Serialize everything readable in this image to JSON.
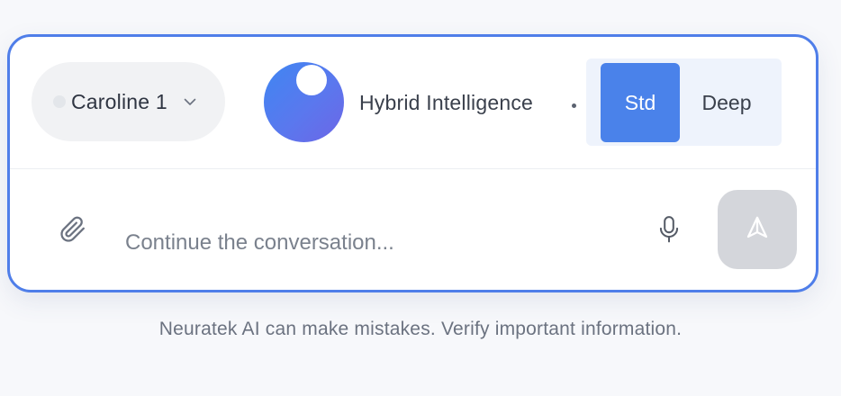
{
  "composer": {
    "model_selector": {
      "label": "Caroline 1",
      "icon": "chevron-down-icon"
    },
    "engine": {
      "label": "Hybrid Intelligence"
    },
    "mode_toggle": {
      "options": [
        {
          "label": "Std",
          "selected": true
        },
        {
          "label": "Deep",
          "selected": false
        }
      ]
    },
    "input": {
      "placeholder": "Continue the conversation...",
      "value": ""
    },
    "icons": {
      "attach": "paperclip-icon",
      "mic": "microphone-icon",
      "send": "send-icon"
    }
  },
  "footer": {
    "disclaimer": "Neuratek AI can make mistakes. Verify important information."
  },
  "colors": {
    "accent": "#4a82ea",
    "border": "#4f7ee9",
    "toggle_bg": "#eef3fc",
    "send_disabled": "#d4d6db"
  }
}
